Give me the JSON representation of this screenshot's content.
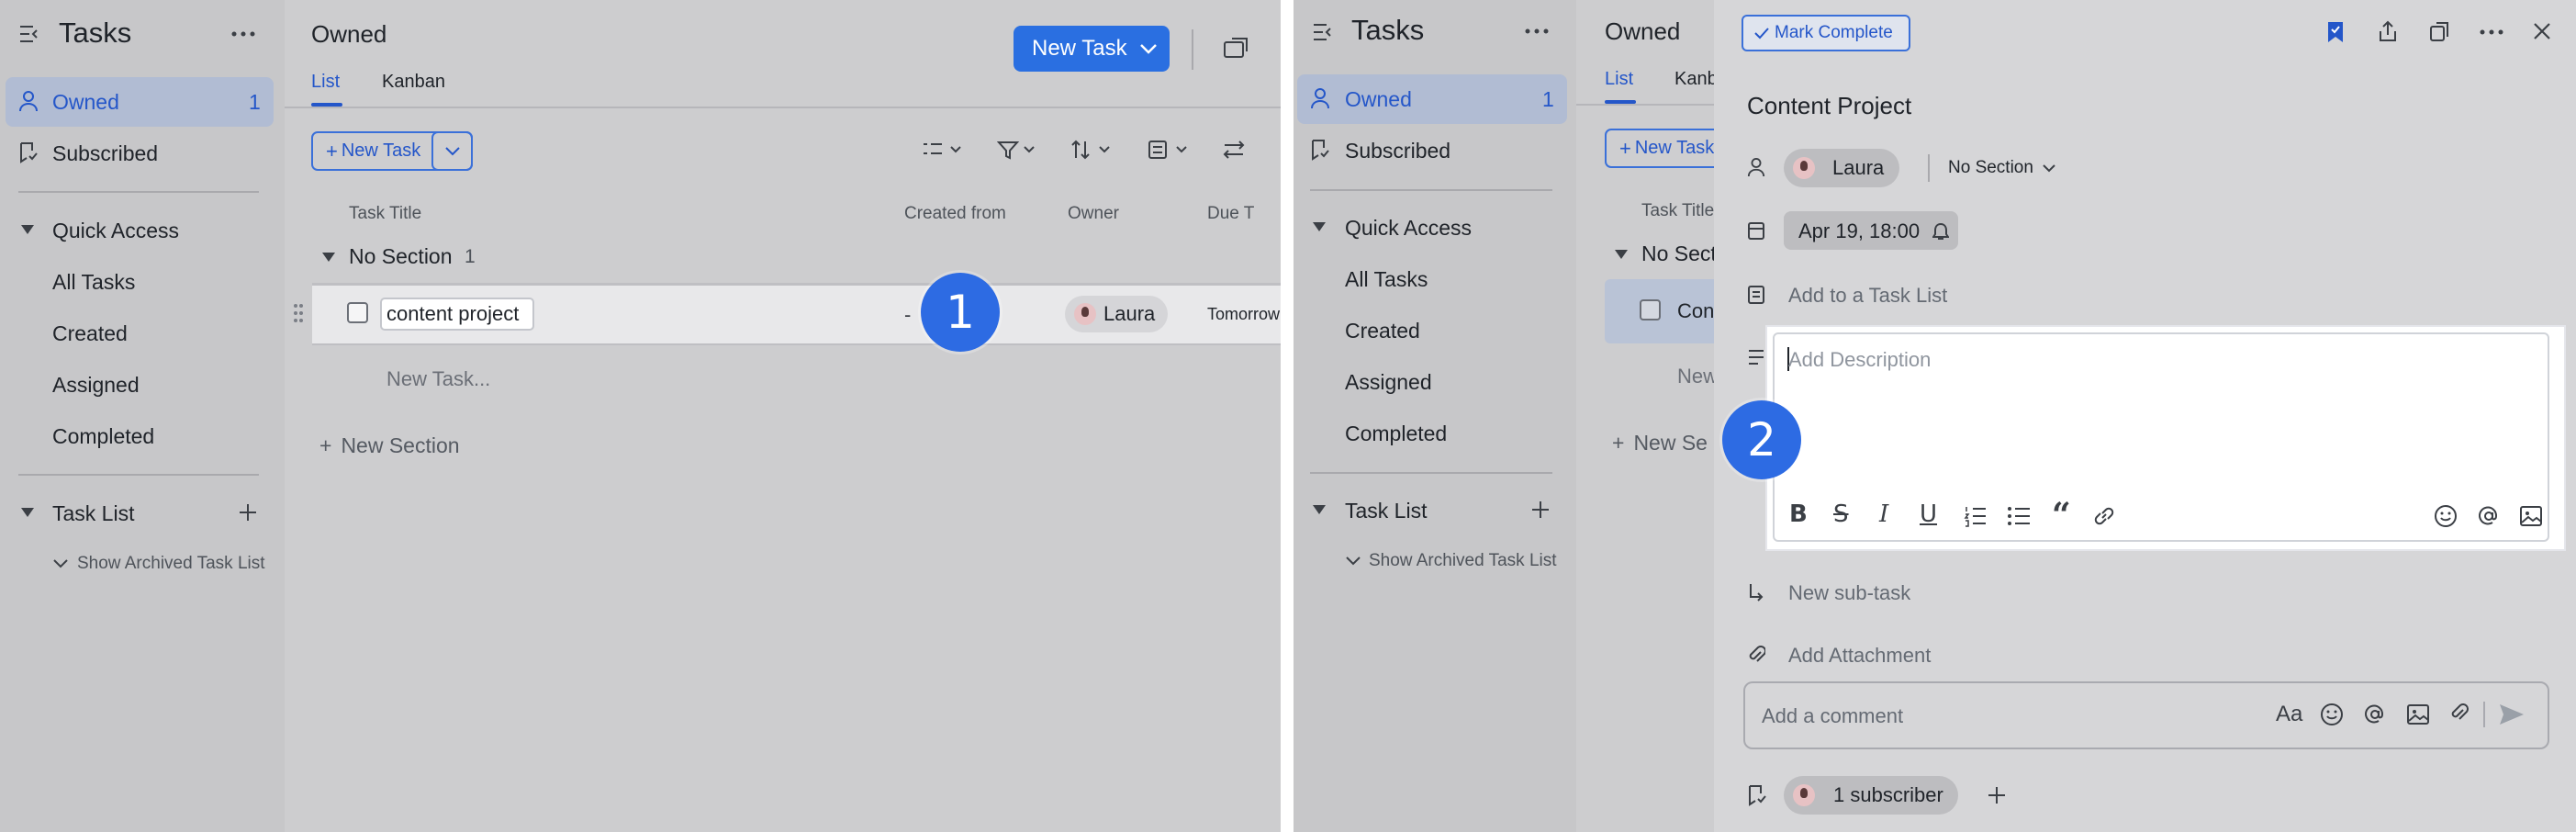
{
  "left": {
    "sidebar": {
      "title": "Tasks",
      "owned_label": "Owned",
      "owned_count": "1",
      "subscribed_label": "Subscribed",
      "quick_access_label": "Quick Access",
      "quick_items": [
        "All Tasks",
        "Created",
        "Assigned",
        "Completed"
      ],
      "task_list_label": "Task List",
      "show_archived": "Show Archived Task List"
    },
    "main": {
      "title": "Owned",
      "new_task_button": "New Task",
      "tabs": [
        "List",
        "Kanban"
      ],
      "small_new_task": "New Task",
      "columns": [
        "Task Title",
        "Created from",
        "Owner",
        "Due T"
      ],
      "section_name": "No Section",
      "section_count": "1",
      "row": {
        "title": "content project",
        "created_from": "-",
        "owner": "Laura",
        "due": "Tomorrow"
      },
      "new_task_placeholder": "New Task...",
      "new_section": "New Section"
    },
    "step_badge": "1"
  },
  "right": {
    "sidebar": {
      "title": "Tasks",
      "owned_label": "Owned",
      "owned_count": "1",
      "subscribed_label": "Subscribed",
      "quick_access_label": "Quick Access",
      "quick_items": [
        "All Tasks",
        "Created",
        "Assigned",
        "Completed"
      ],
      "task_list_label": "Task List",
      "show_archived": "Show Archived Task List"
    },
    "main": {
      "title": "Owned",
      "tabs": [
        "List",
        "Kanb"
      ],
      "small_new_task": "New Task",
      "column_title": "Task Title",
      "section_name": "No Secti",
      "row_title": "Con",
      "new_task_placeholder": "New",
      "new_section": "New Se"
    },
    "detail": {
      "mark_complete": "Mark Complete",
      "title": "Content Project",
      "owner": "Laura",
      "section": "No Section",
      "due": "Apr 19, 18:00",
      "add_to_list": "Add to a Task List",
      "description_placeholder": "Add Description",
      "new_subtask": "New sub-task",
      "add_attachment": "Add Attachment",
      "comment_placeholder": "Add a comment",
      "subscribers": "1 subscriber"
    },
    "step_badge": "2"
  }
}
